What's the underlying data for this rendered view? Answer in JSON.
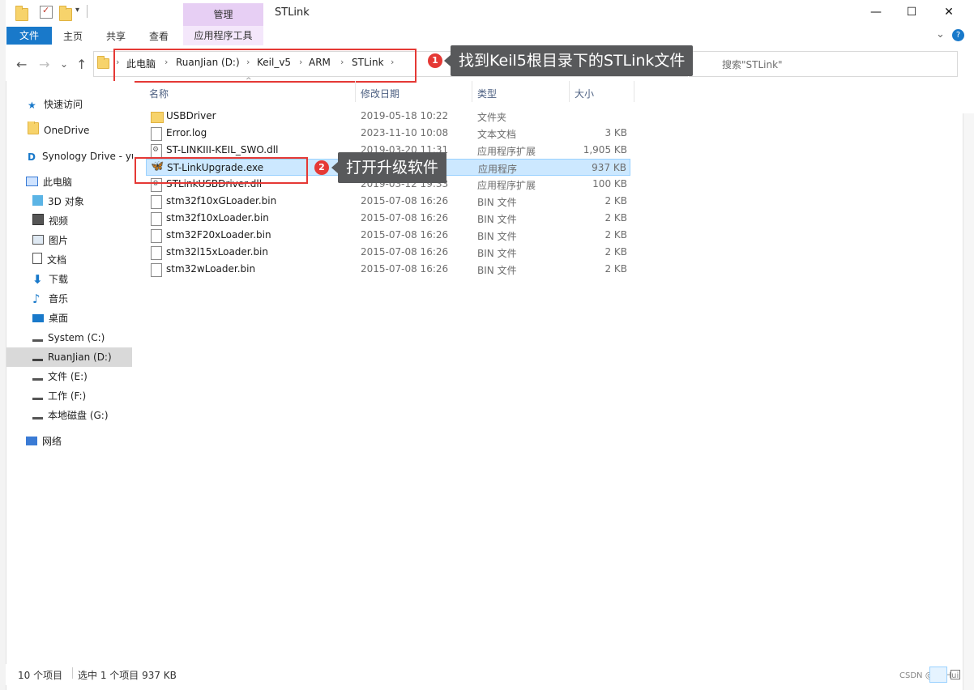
{
  "window": {
    "title": "STLink",
    "context_tab": "管理",
    "minimize": "—",
    "maximize": "☐",
    "close": "✕"
  },
  "ribbon": {
    "file": "文件",
    "home": "主页",
    "share": "共享",
    "view": "查看",
    "app_tools": "应用程序工具",
    "collapse": "⌄",
    "help": "?"
  },
  "nav": {
    "back": "←",
    "forward": "→",
    "recent": "⌄",
    "up": "↑"
  },
  "address": {
    "crumbs": [
      "此电脑",
      "RuanJian (D:)",
      "Keil_v5",
      "ARM",
      "STLink"
    ],
    "sep": "›"
  },
  "search": {
    "placeholder": "搜索\"STLink\""
  },
  "annotations": {
    "step1_num": "1",
    "step1_text": "找到Keil5根目录下的STLink文件",
    "step2_num": "2",
    "step2_text": "打开升级软件"
  },
  "sidebar": {
    "items": [
      {
        "label": "快速访问"
      },
      {
        "label": "OneDrive"
      },
      {
        "label": "Synology Drive - yu"
      },
      {
        "label": "此电脑"
      },
      {
        "label": "3D 对象"
      },
      {
        "label": "视频"
      },
      {
        "label": "图片"
      },
      {
        "label": "文档"
      },
      {
        "label": "下载"
      },
      {
        "label": "音乐"
      },
      {
        "label": "桌面"
      },
      {
        "label": "System (C:)"
      },
      {
        "label": "RuanJian (D:)"
      },
      {
        "label": "文件 (E:)"
      },
      {
        "label": "工作 (F:)"
      },
      {
        "label": "本地磁盘 (G:)"
      },
      {
        "label": "网络"
      }
    ]
  },
  "columns": {
    "name": "名称",
    "date": "修改日期",
    "type": "类型",
    "size": "大小"
  },
  "files": [
    {
      "name": "USBDriver",
      "date": "2019-05-18 10:22",
      "type": "文件夹",
      "size": ""
    },
    {
      "name": "Error.log",
      "date": "2023-11-10 10:08",
      "type": "文本文档",
      "size": "3 KB"
    },
    {
      "name": "ST-LINKIII-KEIL_SWO.dll",
      "date": "2019-03-20 11:31",
      "type": "应用程序扩展",
      "size": "1,905 KB"
    },
    {
      "name": "ST-LinkUpgrade.exe",
      "date": "",
      "type": "应用程序",
      "size": "937 KB"
    },
    {
      "name": "STLinkUSBDriver.dll",
      "date": "2019-03-12 19:33",
      "type": "应用程序扩展",
      "size": "100 KB"
    },
    {
      "name": "stm32f10xGLoader.bin",
      "date": "2015-07-08 16:26",
      "type": "BIN 文件",
      "size": "2 KB"
    },
    {
      "name": "stm32f10xLoader.bin",
      "date": "2015-07-08 16:26",
      "type": "BIN 文件",
      "size": "2 KB"
    },
    {
      "name": "stm32F20xLoader.bin",
      "date": "2015-07-08 16:26",
      "type": "BIN 文件",
      "size": "2 KB"
    },
    {
      "name": "stm32l15xLoader.bin",
      "date": "2015-07-08 16:26",
      "type": "BIN 文件",
      "size": "2 KB"
    },
    {
      "name": "stm32wLoader.bin",
      "date": "2015-07-08 16:26",
      "type": "BIN 文件",
      "size": "2 KB"
    }
  ],
  "status": {
    "count": "10 个项目",
    "selection": "选中 1 个项目  937 KB",
    "watermark": "CSDN @FP Hui"
  },
  "colors": {
    "accent": "#1979ca",
    "selection": "#cce8ff",
    "annotation_red": "#e53935",
    "callout_bg": "#58595b"
  }
}
